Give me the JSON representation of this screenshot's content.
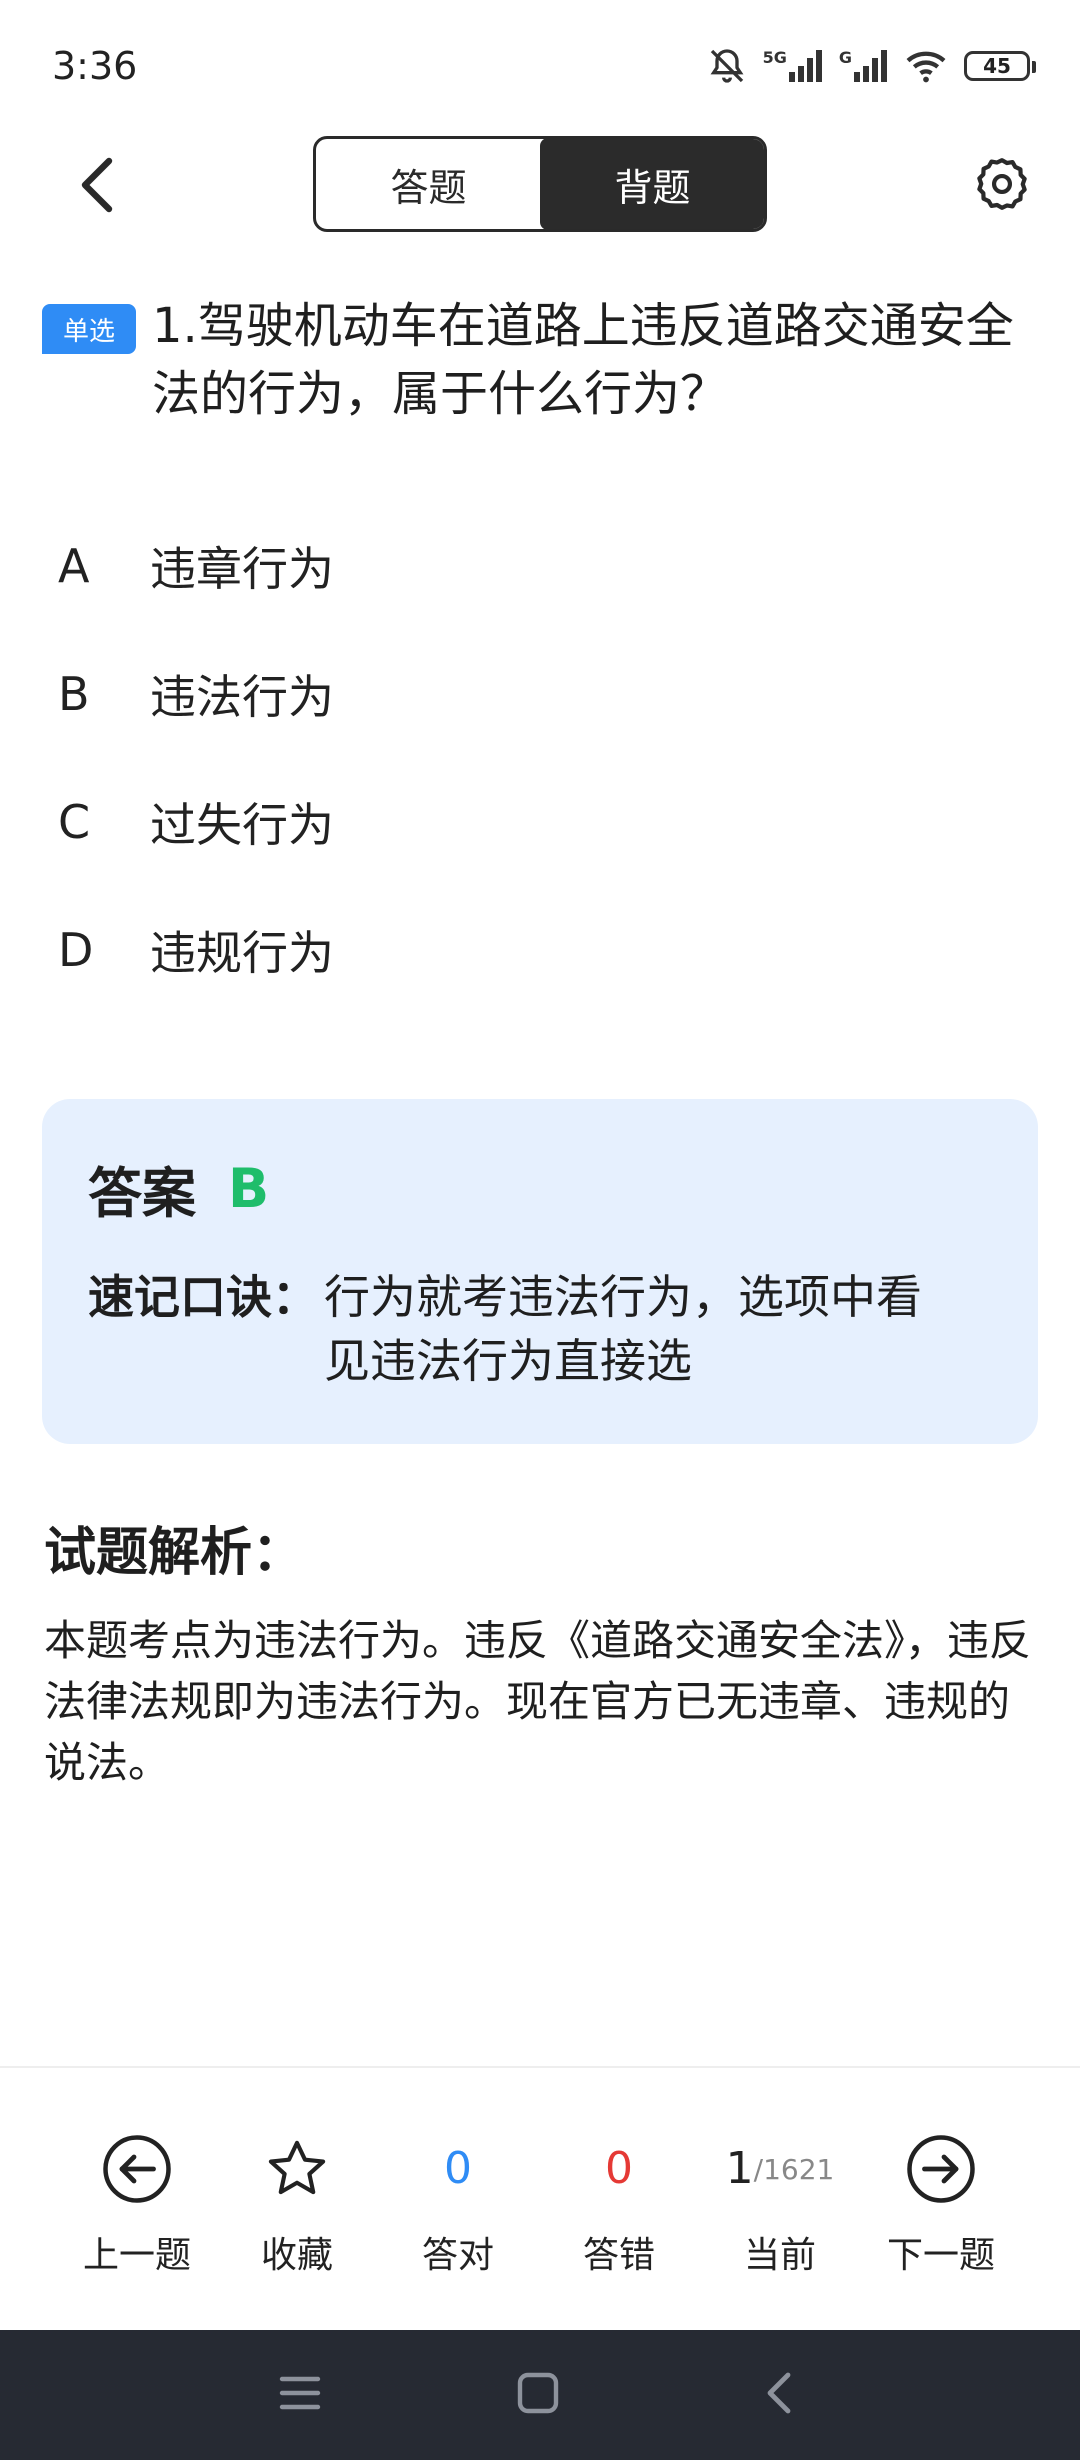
{
  "status_bar": {
    "time": "3:36",
    "network_5g": "5G",
    "network_g": "G",
    "battery": "45"
  },
  "header": {
    "tabs": [
      {
        "label": "答题",
        "active": false
      },
      {
        "label": "背题",
        "active": true
      }
    ]
  },
  "question": {
    "type_tag": "单选",
    "text": "1.驾驶机动车在道路上违反道路交通安全法的行为，属于什么行为？",
    "options": [
      {
        "letter": "A",
        "text": "违章行为"
      },
      {
        "letter": "B",
        "text": "违法行为"
      },
      {
        "letter": "C",
        "text": "过失行为"
      },
      {
        "letter": "D",
        "text": "违规行为"
      }
    ]
  },
  "answer": {
    "label": "答案",
    "value": "B",
    "mnemonic_label": "速记口诀：",
    "mnemonic_text": "行为就考违法行为，选项中看见违法行为直接选"
  },
  "analysis": {
    "title": "试题解析：",
    "text": "本题考点为违法行为。违反《道路交通安全法》，违反法律法规即为违法行为。现在官方已无违章、违规的说法。"
  },
  "toolbar": {
    "prev_label": "上一题",
    "favorite_label": "收藏",
    "correct_count": "0",
    "correct_label": "答对",
    "wrong_count": "0",
    "wrong_label": "答错",
    "current_index": "1",
    "total": "/1621",
    "current_label": "当前",
    "next_label": "下一题"
  },
  "colors": {
    "accent_blue": "#2f8cf5",
    "answer_green": "#1fbd6b",
    "wrong_red": "#e53935",
    "answer_bg": "#e6f0fe",
    "navbar_bg": "#262a33"
  }
}
